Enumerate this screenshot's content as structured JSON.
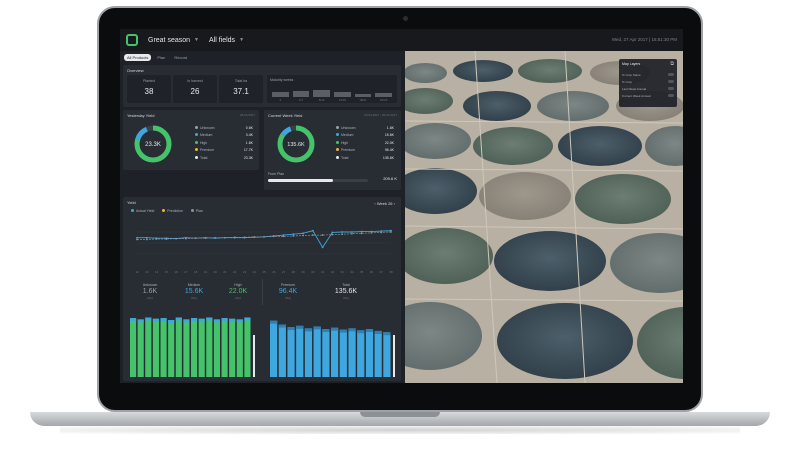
{
  "topbar": {
    "season": "Great season",
    "fields": "All fields",
    "datetime": "Wed, 27 Apr 2017 | 16:51:30 PM"
  },
  "tabs": [
    "All Products",
    "Plan",
    "Record"
  ],
  "overview": {
    "title": "Overview",
    "stats": [
      {
        "label": "Planted",
        "value": "38"
      },
      {
        "label": "In harvest",
        "value": "26"
      },
      {
        "label": "Total ha",
        "value": "37.1"
      }
    ],
    "maturity": {
      "label": "Maturity weeks",
      "bars": [
        {
          "tick": "2",
          "pct": 0.5
        },
        {
          "tick": "4/7",
          "pct": 0.55
        },
        {
          "tick": "8/12",
          "pct": 0.6
        },
        {
          "tick": "13/16",
          "pct": 0.45
        },
        {
          "tick": "18/21",
          "pct": 0.3
        },
        {
          "tick": "22/25",
          "pct": 0.35
        }
      ]
    }
  },
  "yesterday_yield": {
    "title": "Yesterday Yield",
    "date": "26.04.2017",
    "center_value": "23.3K",
    "rows": [
      {
        "label": "Unknown",
        "value": "0.6K",
        "color": "#9aa0a8"
      },
      {
        "label": "Medium",
        "value": "3.4K",
        "color": "#3fa7e0"
      },
      {
        "label": "High",
        "value": "1.6K",
        "color": "#45c36a"
      },
      {
        "label": "Premium",
        "value": "17.7K",
        "color": "#e9b73c"
      },
      {
        "label": "Total",
        "value": "23.3K",
        "color": "#e6e8ec"
      }
    ]
  },
  "current_week_yield": {
    "title": "Current Week Yield",
    "date": "20.04.2017 - 26.04.2017",
    "center_value": "135.6K",
    "rows": [
      {
        "label": "Unknown",
        "value": "1.6K",
        "color": "#9aa0a8"
      },
      {
        "label": "Medium",
        "value": "15.6K",
        "color": "#3fa7e0"
      },
      {
        "label": "High",
        "value": "22.0K",
        "color": "#45c36a"
      },
      {
        "label": "Premium",
        "value": "96.4K",
        "color": "#e9b73c"
      },
      {
        "label": "Total",
        "value": "135.6K",
        "color": "#e6e8ec"
      }
    ],
    "from_plan_label": "From Plan",
    "from_plan_value": "209.6 K",
    "from_plan_pct": 0.65
  },
  "yield": {
    "title": "Yield",
    "week_label": "Week 26",
    "legend": [
      {
        "label": "Actual Yield",
        "color": "#3fa7e0"
      },
      {
        "label": "Prediction",
        "color": "#e9b73c"
      },
      {
        "label": "Plan",
        "color": "#8b9098"
      }
    ],
    "kpis": [
      {
        "label": "Unknown",
        "value": "1.6K",
        "unit": "(lbs)",
        "color": "#9aa0a8"
      },
      {
        "label": "Medium",
        "value": "15.6K",
        "unit": "(lbs)",
        "color": "#3fa7e0"
      },
      {
        "label": "High",
        "value": "22.0K",
        "unit": "(lbs)",
        "color": "#45c36a"
      },
      {
        "label": "Premium",
        "value": "96.4K",
        "unit": "(lbs)",
        "color": "#3fa7e0"
      },
      {
        "label": "Total",
        "value": "135.6K",
        "unit": "(lbs)",
        "color": "#e6e8ec"
      }
    ]
  },
  "map": {
    "layers_title": "Map Layers",
    "layers": [
      {
        "label": "% Crop Same"
      },
      {
        "label": "% Crop"
      },
      {
        "label": "Last Week Annual"
      },
      {
        "label": "Current Week Annual"
      }
    ]
  },
  "chart_data": [
    {
      "type": "line",
      "title": "Yield",
      "x": [
        12,
        13,
        14,
        15,
        16,
        17,
        18,
        19,
        20,
        21,
        22,
        23,
        24,
        25,
        26,
        27,
        28,
        29,
        30,
        31,
        32,
        33,
        34,
        35,
        36,
        37,
        38
      ],
      "ylim": [
        0,
        100
      ],
      "series": [
        {
          "name": "Actual Yield",
          "values": [
            62,
            62,
            61,
            61,
            60,
            62,
            61,
            62,
            61,
            62,
            62,
            62,
            63,
            64,
            66,
            68,
            70,
            72,
            78,
            40,
            74,
            75,
            75,
            76,
            76,
            77,
            78
          ]
        },
        {
          "name": "Plan",
          "values": [
            58,
            58,
            59,
            59,
            60,
            60,
            61,
            61,
            62,
            62,
            63,
            63,
            64,
            64,
            65,
            65,
            66,
            67,
            68,
            68,
            69,
            70,
            71,
            72,
            73,
            74,
            75
          ]
        }
      ]
    },
    {
      "type": "bar",
      "series": [
        {
          "values": [
            92,
            90,
            93,
            91,
            92,
            89,
            93,
            90,
            92,
            91,
            93,
            90,
            92,
            91,
            90,
            93
          ]
        }
      ]
    },
    {
      "type": "bar",
      "series": [
        {
          "values": [
            88,
            82,
            78,
            80,
            76,
            79,
            75,
            77,
            74,
            76,
            73,
            75,
            72,
            70
          ]
        }
      ]
    }
  ]
}
